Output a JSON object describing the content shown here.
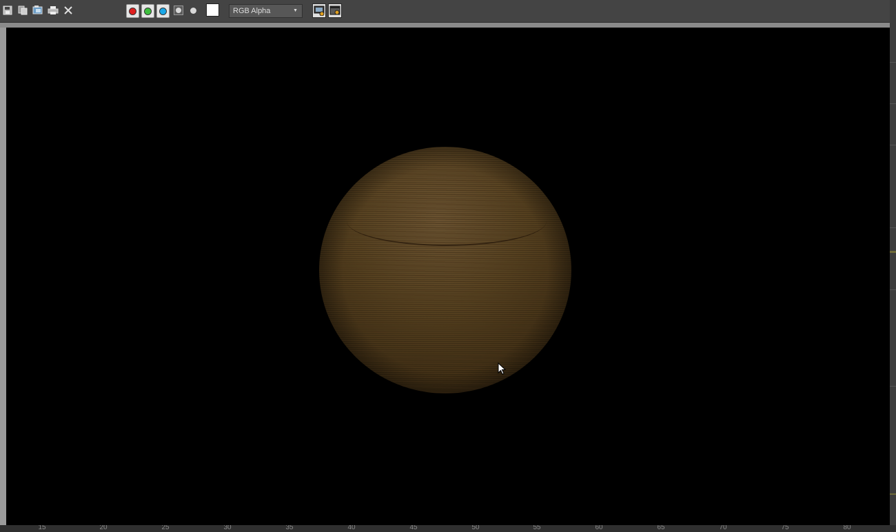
{
  "toolbar": {
    "icons": [
      "save-icon",
      "copy-icon",
      "clone-icon",
      "print-icon",
      "close-icon"
    ],
    "channel_buttons": [
      {
        "name": "red-channel",
        "color": "#e02020"
      },
      {
        "name": "green-channel",
        "color": "#3fbf3f"
      },
      {
        "name": "blue-channel",
        "color": "#1aa8e8"
      }
    ],
    "mono_icon": "monochrome-icon",
    "clear_icon": "clear-icon",
    "background_swatch_color": "#ffffff",
    "channel_dropdown": {
      "value": "RGB Alpha"
    },
    "viewport_buttons": [
      "render-to-viewport-icon",
      "render-window-icon"
    ]
  },
  "viewport": {
    "background": "#000000",
    "object": "wood-textured-sphere"
  },
  "ruler": {
    "ticks": [
      "15",
      "20",
      "25",
      "30",
      "35",
      "40",
      "45",
      "50",
      "55",
      "60",
      "65",
      "70",
      "75",
      "80"
    ]
  }
}
